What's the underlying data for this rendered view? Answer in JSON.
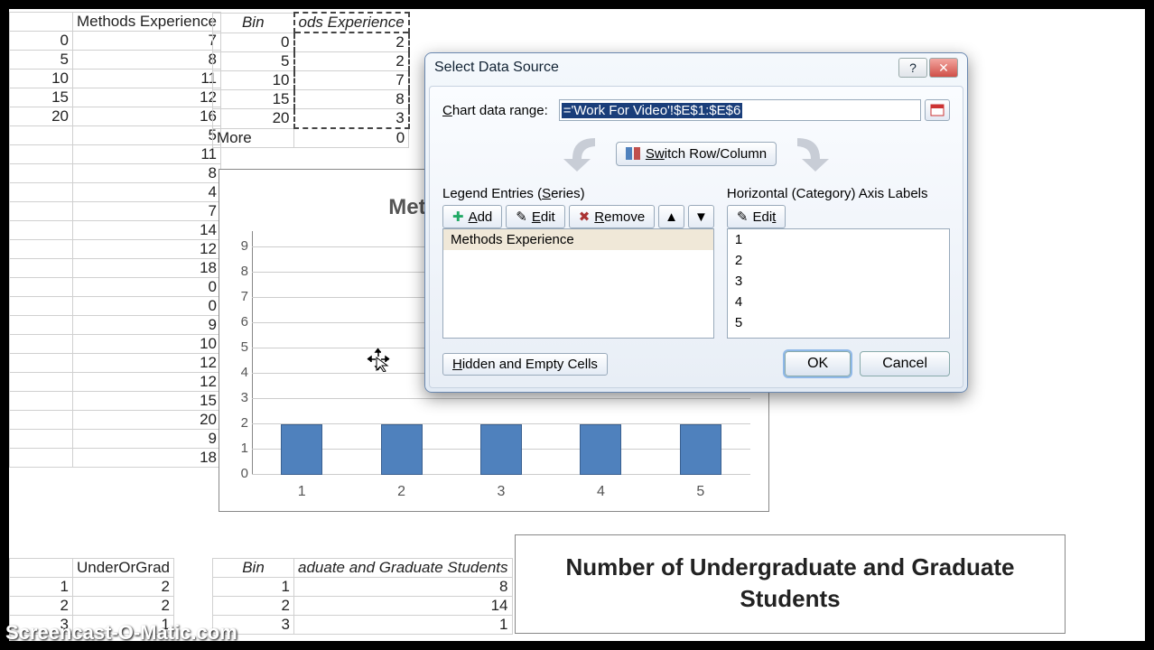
{
  "sheets": {
    "s1": {
      "header": [
        "",
        "Methods Experience"
      ],
      "rows": [
        [
          "0",
          "7"
        ],
        [
          "5",
          "8"
        ],
        [
          "10",
          "11"
        ],
        [
          "15",
          "12"
        ],
        [
          "20",
          "16"
        ],
        [
          "",
          "5"
        ],
        [
          "",
          "11"
        ],
        [
          "",
          "8"
        ],
        [
          "",
          "4"
        ],
        [
          "",
          "7"
        ],
        [
          "",
          "14"
        ],
        [
          "",
          "12"
        ],
        [
          "",
          "18"
        ],
        [
          "",
          "0"
        ],
        [
          "",
          "0"
        ],
        [
          "",
          "9"
        ],
        [
          "",
          "10"
        ],
        [
          "",
          "12"
        ],
        [
          "",
          "12"
        ],
        [
          "",
          "15"
        ],
        [
          "",
          "20"
        ],
        [
          "",
          "9"
        ],
        [
          "",
          "18"
        ]
      ]
    },
    "s2": {
      "header": [
        "Bin",
        "ods Experience"
      ],
      "rows": [
        [
          "0",
          "2"
        ],
        [
          "5",
          "2"
        ],
        [
          "10",
          "7"
        ],
        [
          "15",
          "8"
        ],
        [
          "20",
          "3"
        ],
        [
          "More",
          "0"
        ]
      ]
    },
    "s3": {
      "header": [
        "",
        "UnderOrGrad"
      ],
      "rows": [
        [
          "1",
          "2"
        ],
        [
          "2",
          "2"
        ],
        [
          "3",
          "1"
        ]
      ]
    },
    "s4": {
      "header": [
        "Bin",
        "aduate and Graduate Students"
      ],
      "rows": [
        [
          "1",
          "8"
        ],
        [
          "2",
          "14"
        ],
        [
          "3",
          "1"
        ]
      ]
    }
  },
  "chart1": {
    "title": "Methods Experience"
  },
  "chart_data": {
    "type": "bar",
    "title": "Methods Experience",
    "categories": [
      "1",
      "2",
      "3",
      "4",
      "5"
    ],
    "values": [
      2,
      2,
      2,
      2,
      2
    ],
    "ylabel": "",
    "xlabel": "",
    "ylim": [
      0,
      9
    ],
    "yticks": [
      0,
      1,
      2,
      3,
      4,
      5,
      6,
      7,
      8,
      9
    ]
  },
  "chart2": {
    "title": "Number of Undergraduate and Graduate Students"
  },
  "dialog": {
    "title": "Select Data Source",
    "range_label": "Chart data range:",
    "range_value": "='Work For Video'!$E$1:$E$6",
    "switch_label": "Switch Row/Column",
    "legend_label": "Legend Entries (Series)",
    "axis_label": "Horizontal (Category) Axis Labels",
    "add": "Add",
    "edit": "Edit",
    "remove": "Remove",
    "series": [
      "Methods Experience"
    ],
    "categories": [
      "1",
      "2",
      "3",
      "4",
      "5"
    ],
    "hidden": "Hidden and Empty Cells",
    "ok": "OK",
    "cancel": "Cancel"
  },
  "watermark": "Screencast-O-Matic.com"
}
